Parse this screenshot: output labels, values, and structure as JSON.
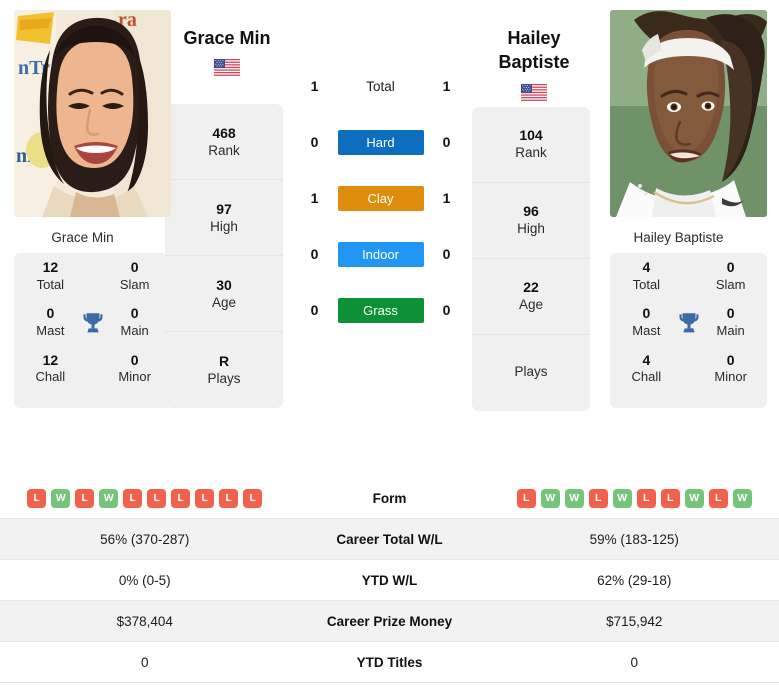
{
  "players": {
    "left": {
      "name": "Grace Min",
      "name_under_photo": "Grace Min",
      "flag": "us-flag-icon",
      "cards": [
        {
          "value": "468",
          "label": "Rank"
        },
        {
          "value": "97",
          "label": "High"
        },
        {
          "value": "30",
          "label": "Age"
        },
        {
          "value": "R",
          "label": "Plays"
        }
      ],
      "titles": {
        "total": "12",
        "total_label": "Total",
        "slam": "0",
        "slam_label": "Slam",
        "mast": "0",
        "mast_label": "Mast",
        "main": "0",
        "main_label": "Main",
        "chall": "12",
        "chall_label": "Chall",
        "minor": "0",
        "minor_label": "Minor"
      },
      "h2h": {
        "total": "1",
        "hard": "0",
        "clay": "1",
        "indoor": "0",
        "grass": "0"
      },
      "form": [
        "L",
        "W",
        "L",
        "W",
        "L",
        "L",
        "L",
        "L",
        "L",
        "L"
      ],
      "career_total_wl": "56% (370-287)",
      "ytd_wl": "0% (0-5)",
      "career_prize_money": "$378,404",
      "ytd_titles": "0"
    },
    "right": {
      "name": "Hailey Baptiste",
      "name_line1": "Hailey",
      "name_line2": "Baptiste",
      "name_under_photo": "Hailey Baptiste",
      "flag": "us-flag-icon",
      "cards": [
        {
          "value": "104",
          "label": "Rank"
        },
        {
          "value": "96",
          "label": "High"
        },
        {
          "value": "22",
          "label": "Age"
        },
        {
          "value": "",
          "label": "Plays"
        }
      ],
      "titles": {
        "total": "4",
        "total_label": "Total",
        "slam": "0",
        "slam_label": "Slam",
        "mast": "0",
        "mast_label": "Mast",
        "main": "0",
        "main_label": "Main",
        "chall": "4",
        "chall_label": "Chall",
        "minor": "0",
        "minor_label": "Minor"
      },
      "h2h": {
        "total": "1",
        "hard": "0",
        "clay": "1",
        "indoor": "0",
        "grass": "0"
      },
      "form": [
        "L",
        "W",
        "W",
        "L",
        "W",
        "L",
        "L",
        "W",
        "L",
        "W"
      ],
      "career_total_wl": "59% (183-125)",
      "ytd_wl": "62% (29-18)",
      "career_prize_money": "$715,942",
      "ytd_titles": "0"
    }
  },
  "surfaces": {
    "total_label": "Total",
    "hard_label": "Hard",
    "clay_label": "Clay",
    "indoor_label": "Indoor",
    "grass_label": "Grass",
    "colors": {
      "hard": "#0d6ebd",
      "clay": "#e08c0d",
      "indoor": "#2196f3",
      "grass": "#0d9136"
    }
  },
  "table": {
    "form_label": "Form",
    "career_total_wl_label": "Career Total W/L",
    "ytd_wl_label": "YTD W/L",
    "career_prize_money_label": "Career Prize Money",
    "ytd_titles_label": "YTD Titles"
  },
  "theme": {
    "card_bg": "#f0f0f0",
    "row_alt_bg": "#f2f2f2",
    "win_color": "#74c47a",
    "loss_color": "#f1614c",
    "trophy_color": "#3b6ba5"
  }
}
